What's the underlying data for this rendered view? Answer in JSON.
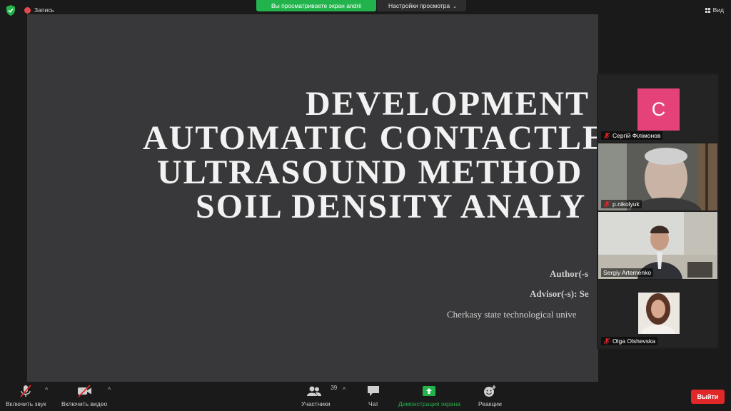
{
  "topbar": {
    "record_label": "Запись",
    "share_notice": "Вы просматриваете экран andrii",
    "view_options": "Настройки просмотра",
    "view_label": "Вид"
  },
  "slide": {
    "title_lines": [
      "DEVELOPMENT",
      "AUTOMATIC CONTACTLE",
      "ULTRASOUND METHOD",
      "SOIL DENSITY ANALY"
    ],
    "author_label": "Author(-s",
    "advisor_label": "Advisor(-s): Se",
    "university": "Cherkasy state technological unive"
  },
  "participants": [
    {
      "name": "Сергій Філімонов",
      "initial": "С",
      "muted": true,
      "avatar_color": "#e5427a"
    },
    {
      "name": "p.nikolyuk",
      "muted": true
    },
    {
      "name": "Sergiy Artemenko",
      "muted": false
    },
    {
      "name": "Olga Olshevska",
      "muted": true
    }
  ],
  "toolbar": {
    "audio_label": "Включить звук",
    "video_label": "Включить видео",
    "participants_label": "Участники",
    "participants_count": "39",
    "chat_label": "Чат",
    "share_label": "Демонстрация экрана",
    "reactions_label": "Реакции",
    "leave_label": "Выйти"
  },
  "colors": {
    "accent_green": "#23b34c",
    "leave_red": "#e02828",
    "slide_bg": "#383739"
  }
}
